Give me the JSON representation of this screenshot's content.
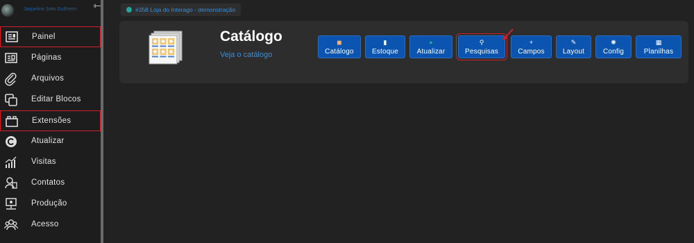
{
  "sidebar": {
    "user_name": "Jaqueline Seto Guilherm",
    "items": [
      {
        "label": "Painel",
        "icon": "dashboard-icon"
      },
      {
        "label": "Páginas",
        "icon": "pages-icon"
      },
      {
        "label": "Arquivos",
        "icon": "paperclip-icon"
      },
      {
        "label": "Editar Blocos",
        "icon": "blocks-icon"
      },
      {
        "label": "Extensões",
        "icon": "extensions-icon"
      },
      {
        "label": "Atualizar",
        "icon": "refresh-icon"
      },
      {
        "label": "Visitas",
        "icon": "stats-icon"
      },
      {
        "label": "Contatos",
        "icon": "contacts-icon"
      },
      {
        "label": "Produção",
        "icon": "production-icon"
      },
      {
        "label": "Acesso",
        "icon": "users-icon"
      }
    ]
  },
  "breadcrumb": {
    "text": "#358 Loja do Interago - demonstração"
  },
  "header": {
    "title": "Catálogo",
    "link": "Veja o catálogo"
  },
  "toolbar": [
    {
      "label": "Catálogo",
      "icon": "box-icon",
      "glyph": "◼"
    },
    {
      "label": "Estoque",
      "icon": "stock-icon",
      "glyph": "▮"
    },
    {
      "label": "Atualizar",
      "icon": "refresh-dot-icon",
      "glyph": "●"
    },
    {
      "label": "Pesquisas",
      "icon": "search-icon",
      "glyph": "⚲"
    },
    {
      "label": "Campos",
      "icon": "plus-icon",
      "glyph": "+"
    },
    {
      "label": "Layout",
      "icon": "pen-icon",
      "glyph": "✎"
    },
    {
      "label": "Config",
      "icon": "gear-icon",
      "glyph": "✺"
    },
    {
      "label": "Planilhas",
      "icon": "spreadsheet-icon",
      "glyph": "▦"
    }
  ],
  "colors": {
    "accent": "#0b55b0",
    "highlight": "#d0202a",
    "link": "#3b8ed6"
  }
}
